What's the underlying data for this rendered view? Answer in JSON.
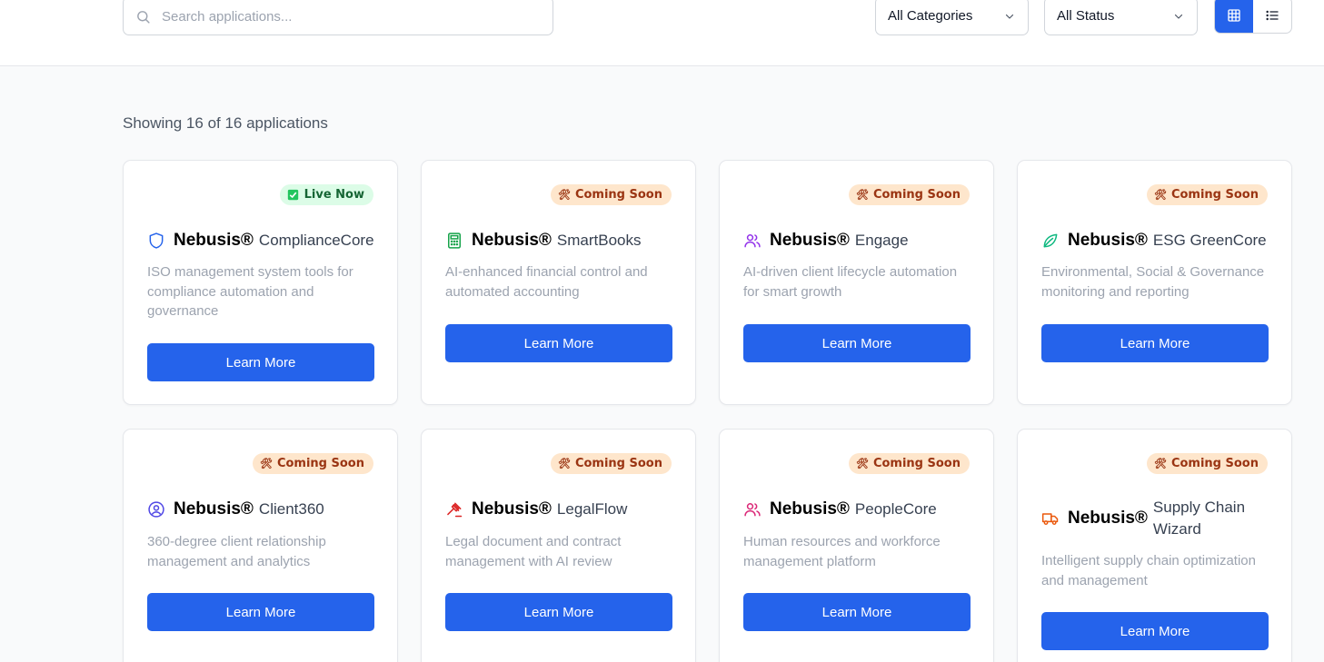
{
  "toolbar": {
    "search_placeholder": "Search applications...",
    "category_select": "All Categories",
    "status_select": "All Status",
    "view_mode": "grid"
  },
  "results": {
    "summary": "Showing 16 of 16 applications"
  },
  "colors": {
    "accent": "#2563eb",
    "live_bg": "#dcfce7",
    "live_text": "#166534",
    "soon_bg": "#fee6cc",
    "soon_text": "#9a3412"
  },
  "apps": [
    {
      "brand": "Nebusis®",
      "product": "ComplianceCore",
      "status": "Live Now",
      "icon": "shield-icon",
      "description": "ISO management system tools for compliance automation and governance",
      "button": "Learn More"
    },
    {
      "brand": "Nebusis®",
      "product": "SmartBooks",
      "status": "Coming Soon",
      "icon": "calculator-icon",
      "description": "AI-enhanced financial control and automated accounting",
      "button": "Learn More"
    },
    {
      "brand": "Nebusis®",
      "product": "Engage",
      "status": "Coming Soon",
      "icon": "users-icon",
      "description": "AI-driven client lifecycle automation for smart growth",
      "button": "Learn More"
    },
    {
      "brand": "Nebusis®",
      "product": "ESG GreenCore",
      "status": "Coming Soon",
      "icon": "leaf-icon",
      "description": "Environmental, Social & Governance monitoring and reporting",
      "button": "Learn More"
    },
    {
      "brand": "Nebusis®",
      "product": "Client360",
      "status": "Coming Soon",
      "icon": "user-circle-icon",
      "description": "360-degree client relationship management and analytics",
      "button": "Learn More"
    },
    {
      "brand": "Nebusis®",
      "product": "LegalFlow",
      "status": "Coming Soon",
      "icon": "gavel-icon",
      "description": "Legal document and contract management with AI review",
      "button": "Learn More"
    },
    {
      "brand": "Nebusis®",
      "product": "PeopleCore",
      "status": "Coming Soon",
      "icon": "users-icon",
      "description": "Human resources and workforce management platform",
      "button": "Learn More"
    },
    {
      "brand": "Nebusis®",
      "product": "Supply Chain Wizard",
      "status": "Coming Soon",
      "icon": "truck-icon",
      "description": "Intelligent supply chain optimization and management",
      "button": "Learn More"
    }
  ]
}
